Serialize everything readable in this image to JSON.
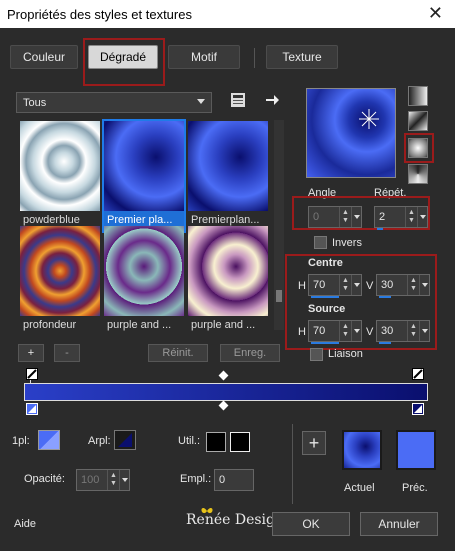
{
  "window": {
    "title": "Propriétés des styles et textures",
    "close_glyph": "✕"
  },
  "tabs": [
    {
      "label": "Couleur"
    },
    {
      "label": "Dégradé"
    },
    {
      "label": "Motif"
    },
    {
      "label": "Texture"
    }
  ],
  "category": {
    "value": "Tous"
  },
  "gradients": [
    {
      "name": "powderblue"
    },
    {
      "name": "Premier pla..."
    },
    {
      "name": "Premierplan..."
    },
    {
      "name": "profondeur"
    },
    {
      "name": "purple and ..."
    },
    {
      "name": "purple and ..."
    }
  ],
  "list_buttons": {
    "add": "+",
    "remove": "-",
    "reset": "Réinit.",
    "save": "Enreg."
  },
  "angle": {
    "label": "Angle",
    "value": "0"
  },
  "repeat": {
    "label": "Répét.",
    "value": "2"
  },
  "invert": {
    "label": "Invers"
  },
  "center": {
    "label": "Centre",
    "h_label": "H",
    "h_value": "70",
    "v_label": "V",
    "v_value": "30"
  },
  "source": {
    "label": "Source",
    "h_label": "H",
    "h_value": "70",
    "v_label": "V",
    "v_value": "30"
  },
  "link": {
    "label": "Liaison"
  },
  "stop_controls": {
    "pos_label": "1pl:",
    "arpl_label": "Arpl:",
    "util_label": "Util.:"
  },
  "opacity": {
    "label": "Opacité:",
    "value": "100"
  },
  "empl": {
    "label": "Empl.:",
    "value": "0"
  },
  "swatches": {
    "current_label": "Actuel",
    "previous_label": "Préc.",
    "add": "+"
  },
  "footer": {
    "help": "Aide",
    "brand": "Renée Design",
    "ok": "OK",
    "cancel": "Annuler"
  },
  "colors": {
    "gradient_dark": "#0a0f6e",
    "gradient_light": "#4b6cf5",
    "selection": "#1f7be8",
    "highlight_box": "#9b1b1b"
  }
}
